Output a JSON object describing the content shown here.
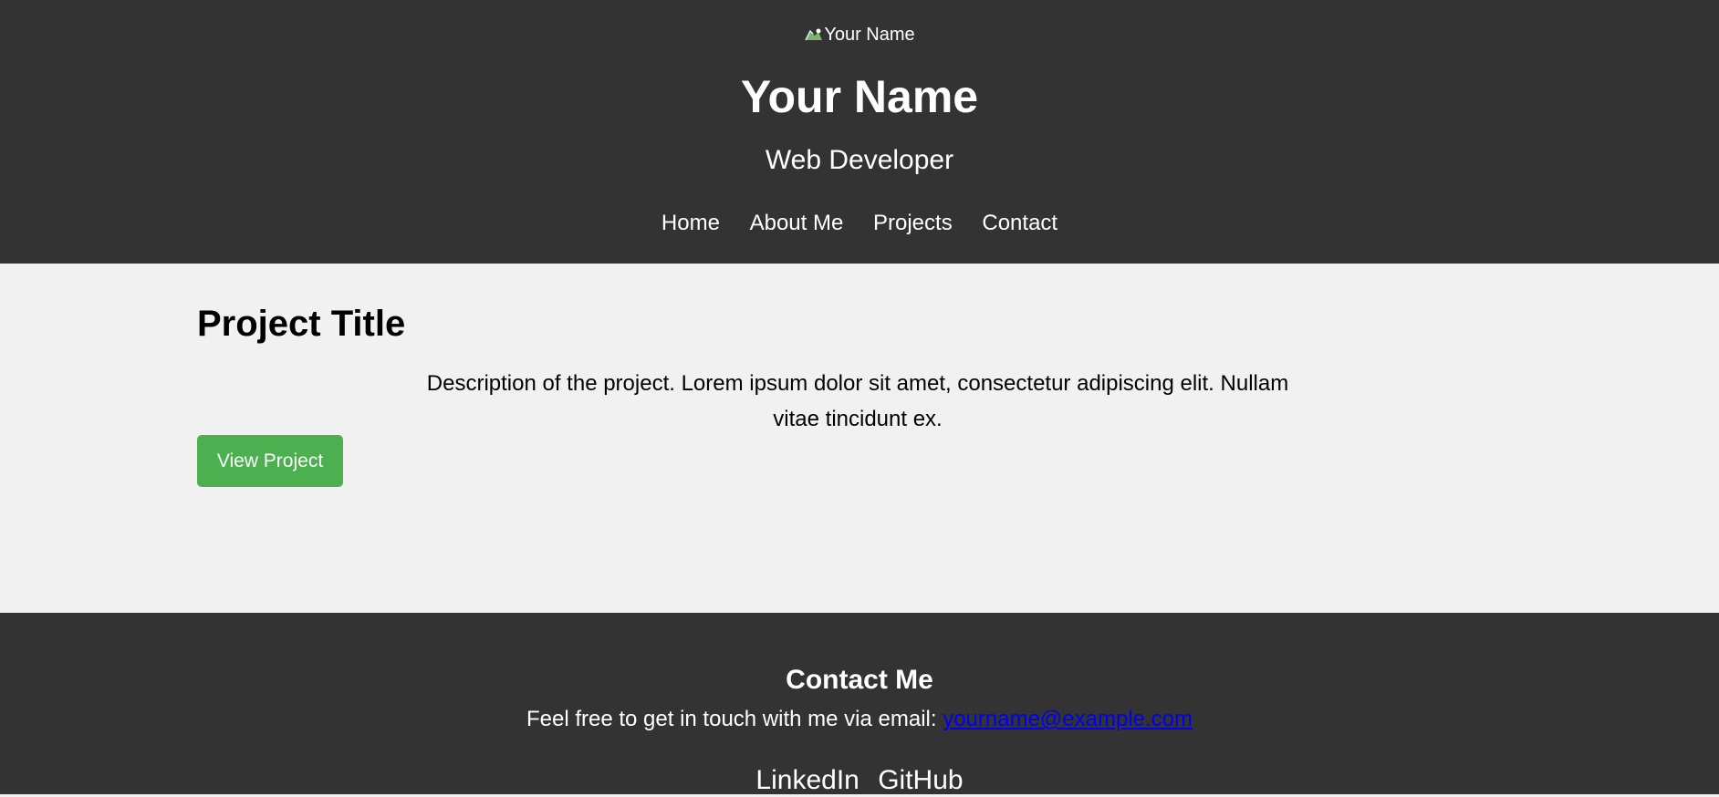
{
  "header": {
    "logo_alt": "Your Name",
    "name": "Your Name",
    "role": "Web Developer",
    "nav": [
      {
        "label": "Home"
      },
      {
        "label": "About Me"
      },
      {
        "label": "Projects"
      },
      {
        "label": "Contact"
      }
    ],
    "colors": {
      "background": "#333333",
      "text": "#ffffff"
    }
  },
  "project": {
    "title": "Project Title",
    "description": "Description of the project. Lorem ipsum dolor sit amet, consectetur adipiscing elit. Nullam vitae tincidunt ex.",
    "button_label": "View Project",
    "button_color": "#4caf50"
  },
  "footer": {
    "heading": "Contact Me",
    "text": "Feel free to get in touch with me via email: ",
    "email": "yourname@example.com",
    "social": [
      {
        "label": "LinkedIn"
      },
      {
        "label": "GitHub"
      }
    ],
    "link_color": "#0000ee"
  },
  "icons": {
    "logo": "broken-image-icon"
  }
}
